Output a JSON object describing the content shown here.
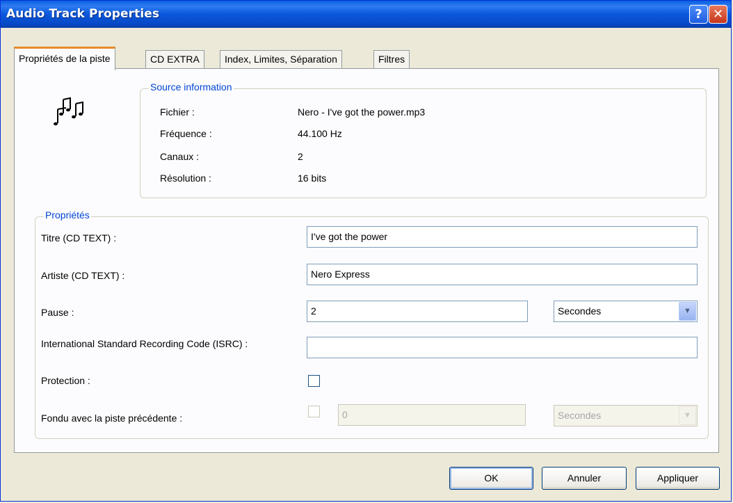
{
  "window": {
    "title": "Audio Track Properties",
    "help_label": "?",
    "close_label": "✕"
  },
  "tabs": [
    {
      "label": "Propriétés de la piste",
      "active": true
    },
    {
      "label": "CD EXTRA",
      "active": false
    },
    {
      "label": "Index, Limites, Séparation",
      "active": false
    },
    {
      "label": "Filtres",
      "active": false
    }
  ],
  "source": {
    "legend": "Source information",
    "icon": "music-notes-icon",
    "rows": [
      {
        "label": "Fichier :",
        "value": "Nero -  I've got the power.mp3"
      },
      {
        "label": "Fréquence :",
        "value": "44.100 Hz"
      },
      {
        "label": "Canaux :",
        "value": "2"
      },
      {
        "label": "Résolution :",
        "value": "16 bits"
      }
    ]
  },
  "props": {
    "legend": "Propriétés",
    "title_label": "Titre (CD TEXT) :",
    "title_value": "I've got the power",
    "artist_label": "Artiste (CD TEXT) :",
    "artist_value": "Nero Express",
    "pause_label": "Pause :",
    "pause_value": "2",
    "pause_unit": "Secondes",
    "isrc_label": "International Standard Recording Code (ISRC) :",
    "isrc_value": "",
    "protection_label": "Protection :",
    "protection_checked": false,
    "fade_label": "Fondu avec la piste précédente :",
    "fade_value": "0",
    "fade_unit": "Secondes",
    "fade_checked": false
  },
  "buttons": {
    "ok": "OK",
    "cancel": "Annuler",
    "apply": "Appliquer"
  }
}
